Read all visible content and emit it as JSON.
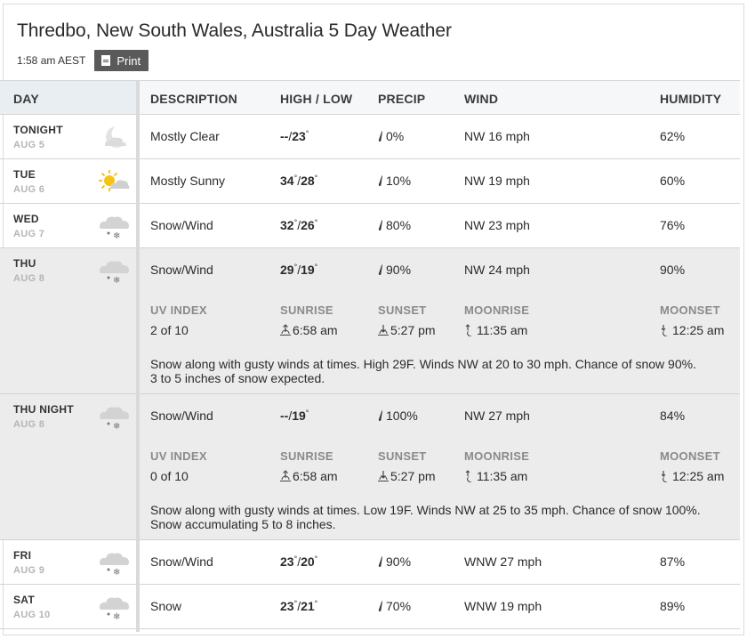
{
  "header": {
    "title": "Thredbo, New South Wales, Australia 5 Day Weather",
    "time": "1:58 am AEST",
    "print_label": "Print"
  },
  "columns": {
    "day": "DAY",
    "description": "DESCRIPTION",
    "high_low": "HIGH / LOW",
    "precip": "PRECIP",
    "wind": "WIND",
    "humidity": "HUMIDITY"
  },
  "detail_labels": {
    "uv": "UV INDEX",
    "sunrise": "SUNRISE",
    "sunset": "SUNSET",
    "moonrise": "MOONRISE",
    "moonset": "MOONSET"
  },
  "rows": [
    {
      "day": "TONIGHT",
      "date": "AUG 5",
      "icon": "moon-icon",
      "desc": "Mostly Clear",
      "high": "--",
      "low": "23",
      "precip": "0%",
      "wind": "NW 16 mph",
      "humidity": "62%"
    },
    {
      "day": "TUE",
      "date": "AUG 6",
      "icon": "sun-cloud-icon",
      "desc": "Mostly Sunny",
      "high": "34",
      "low": "28",
      "precip": "10%",
      "wind": "NW 19 mph",
      "humidity": "60%"
    },
    {
      "day": "WED",
      "date": "AUG 7",
      "icon": "snow-icon",
      "desc": "Snow/Wind",
      "high": "32",
      "low": "26",
      "precip": "80%",
      "wind": "NW 23 mph",
      "humidity": "76%"
    },
    {
      "day": "THU",
      "date": "AUG 8",
      "icon": "snow-icon",
      "desc": "Snow/Wind",
      "high": "29",
      "low": "19",
      "precip": "90%",
      "wind": "NW 24 mph",
      "humidity": "90%",
      "uv": "2 of 10",
      "sunrise": "6:58 am",
      "sunset": "5:27 pm",
      "moonrise": "11:35 am",
      "moonset": "12:25 am",
      "narrative_1": "Snow along with gusty winds at times. High 29F. Winds NW at 20 to 30 mph. Chance of snow 90%.",
      "narrative_2": "3 to 5 inches of snow expected."
    },
    {
      "day": "THU NIGHT",
      "date": "AUG 8",
      "icon": "snow-icon",
      "desc": "Snow/Wind",
      "high": "--",
      "low": "19",
      "precip": "100%",
      "wind": "NW 27 mph",
      "humidity": "84%",
      "uv": "0 of 10",
      "sunrise": "6:58 am",
      "sunset": "5:27 pm",
      "moonrise": "11:35 am",
      "moonset": "12:25 am",
      "narrative_1": "Snow along with gusty winds at times. Low 19F. Winds NW at 25 to 35 mph. Chance of snow 100%.",
      "narrative_2": "Snow accumulating 5 to 8 inches."
    },
    {
      "day": "FRI",
      "date": "AUG 9",
      "icon": "snow-icon",
      "desc": "Snow/Wind",
      "high": "23",
      "low": "20",
      "precip": "90%",
      "wind": "WNW 27 mph",
      "humidity": "87%"
    },
    {
      "day": "SAT",
      "date": "AUG 10",
      "icon": "snow-icon",
      "desc": "Snow",
      "high": "23",
      "low": "21",
      "precip": "70%",
      "wind": "WNW 19 mph",
      "humidity": "89%"
    }
  ],
  "deg_symbol": "°",
  "slash": "/"
}
